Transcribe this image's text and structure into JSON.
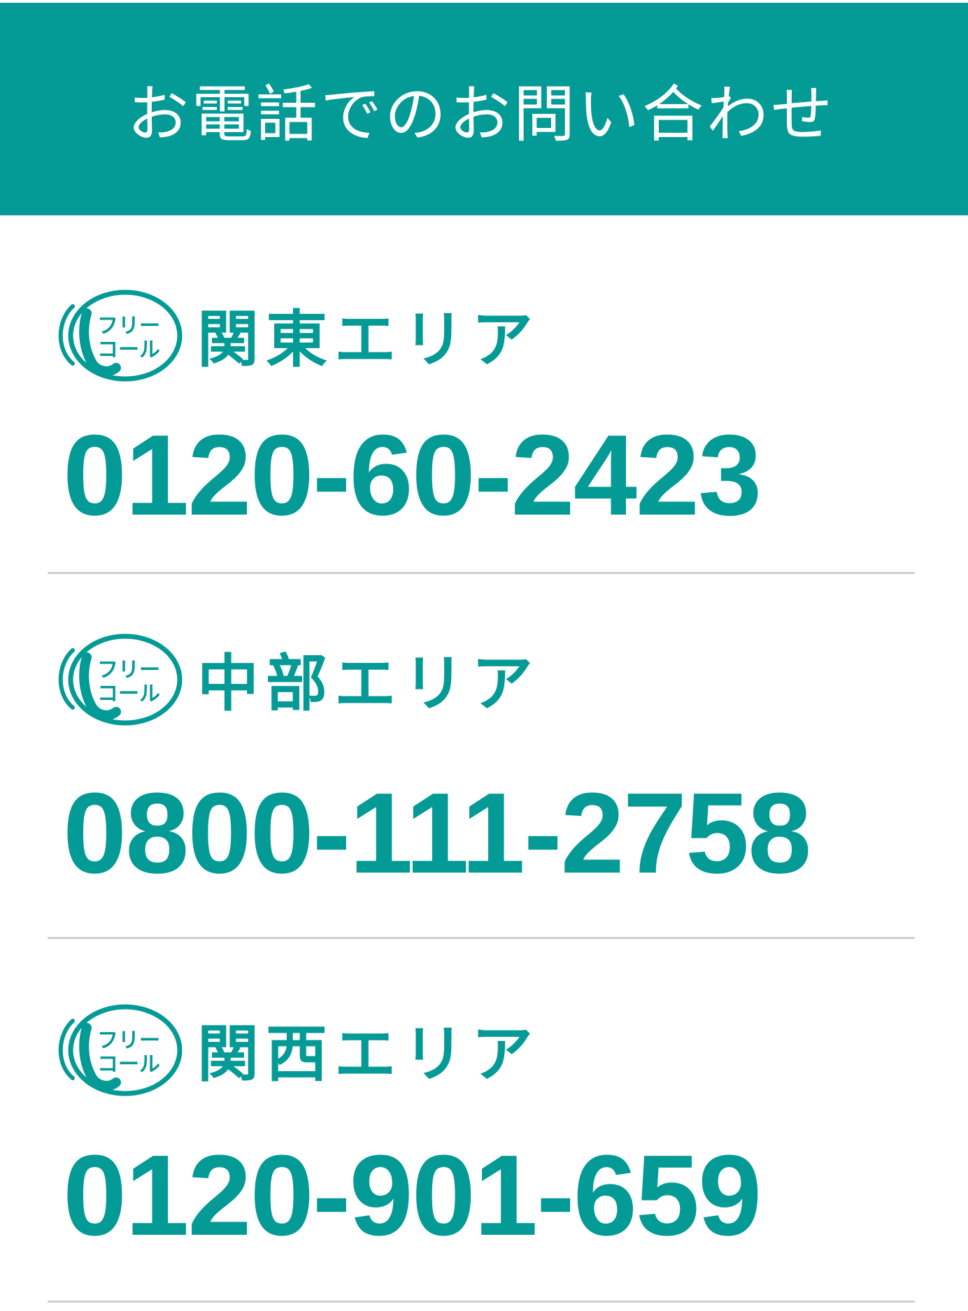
{
  "header": {
    "title": "お電話でのお問い合わせ"
  },
  "freecall_icon": {
    "name": "freecall-phone-icon",
    "text_line1": "フリー",
    "text_line2": "コール"
  },
  "areas": [
    {
      "name": "関東エリア",
      "phone": "0120-60-2423"
    },
    {
      "name": "中部エリア",
      "phone": "0800-111-2758"
    },
    {
      "name": "関西エリア",
      "phone": "0120-901-659"
    }
  ],
  "colors": {
    "accent": "#049a96",
    "header_text": "#ffffff",
    "divider": "#cfcfcf",
    "background": "#ffffff"
  }
}
